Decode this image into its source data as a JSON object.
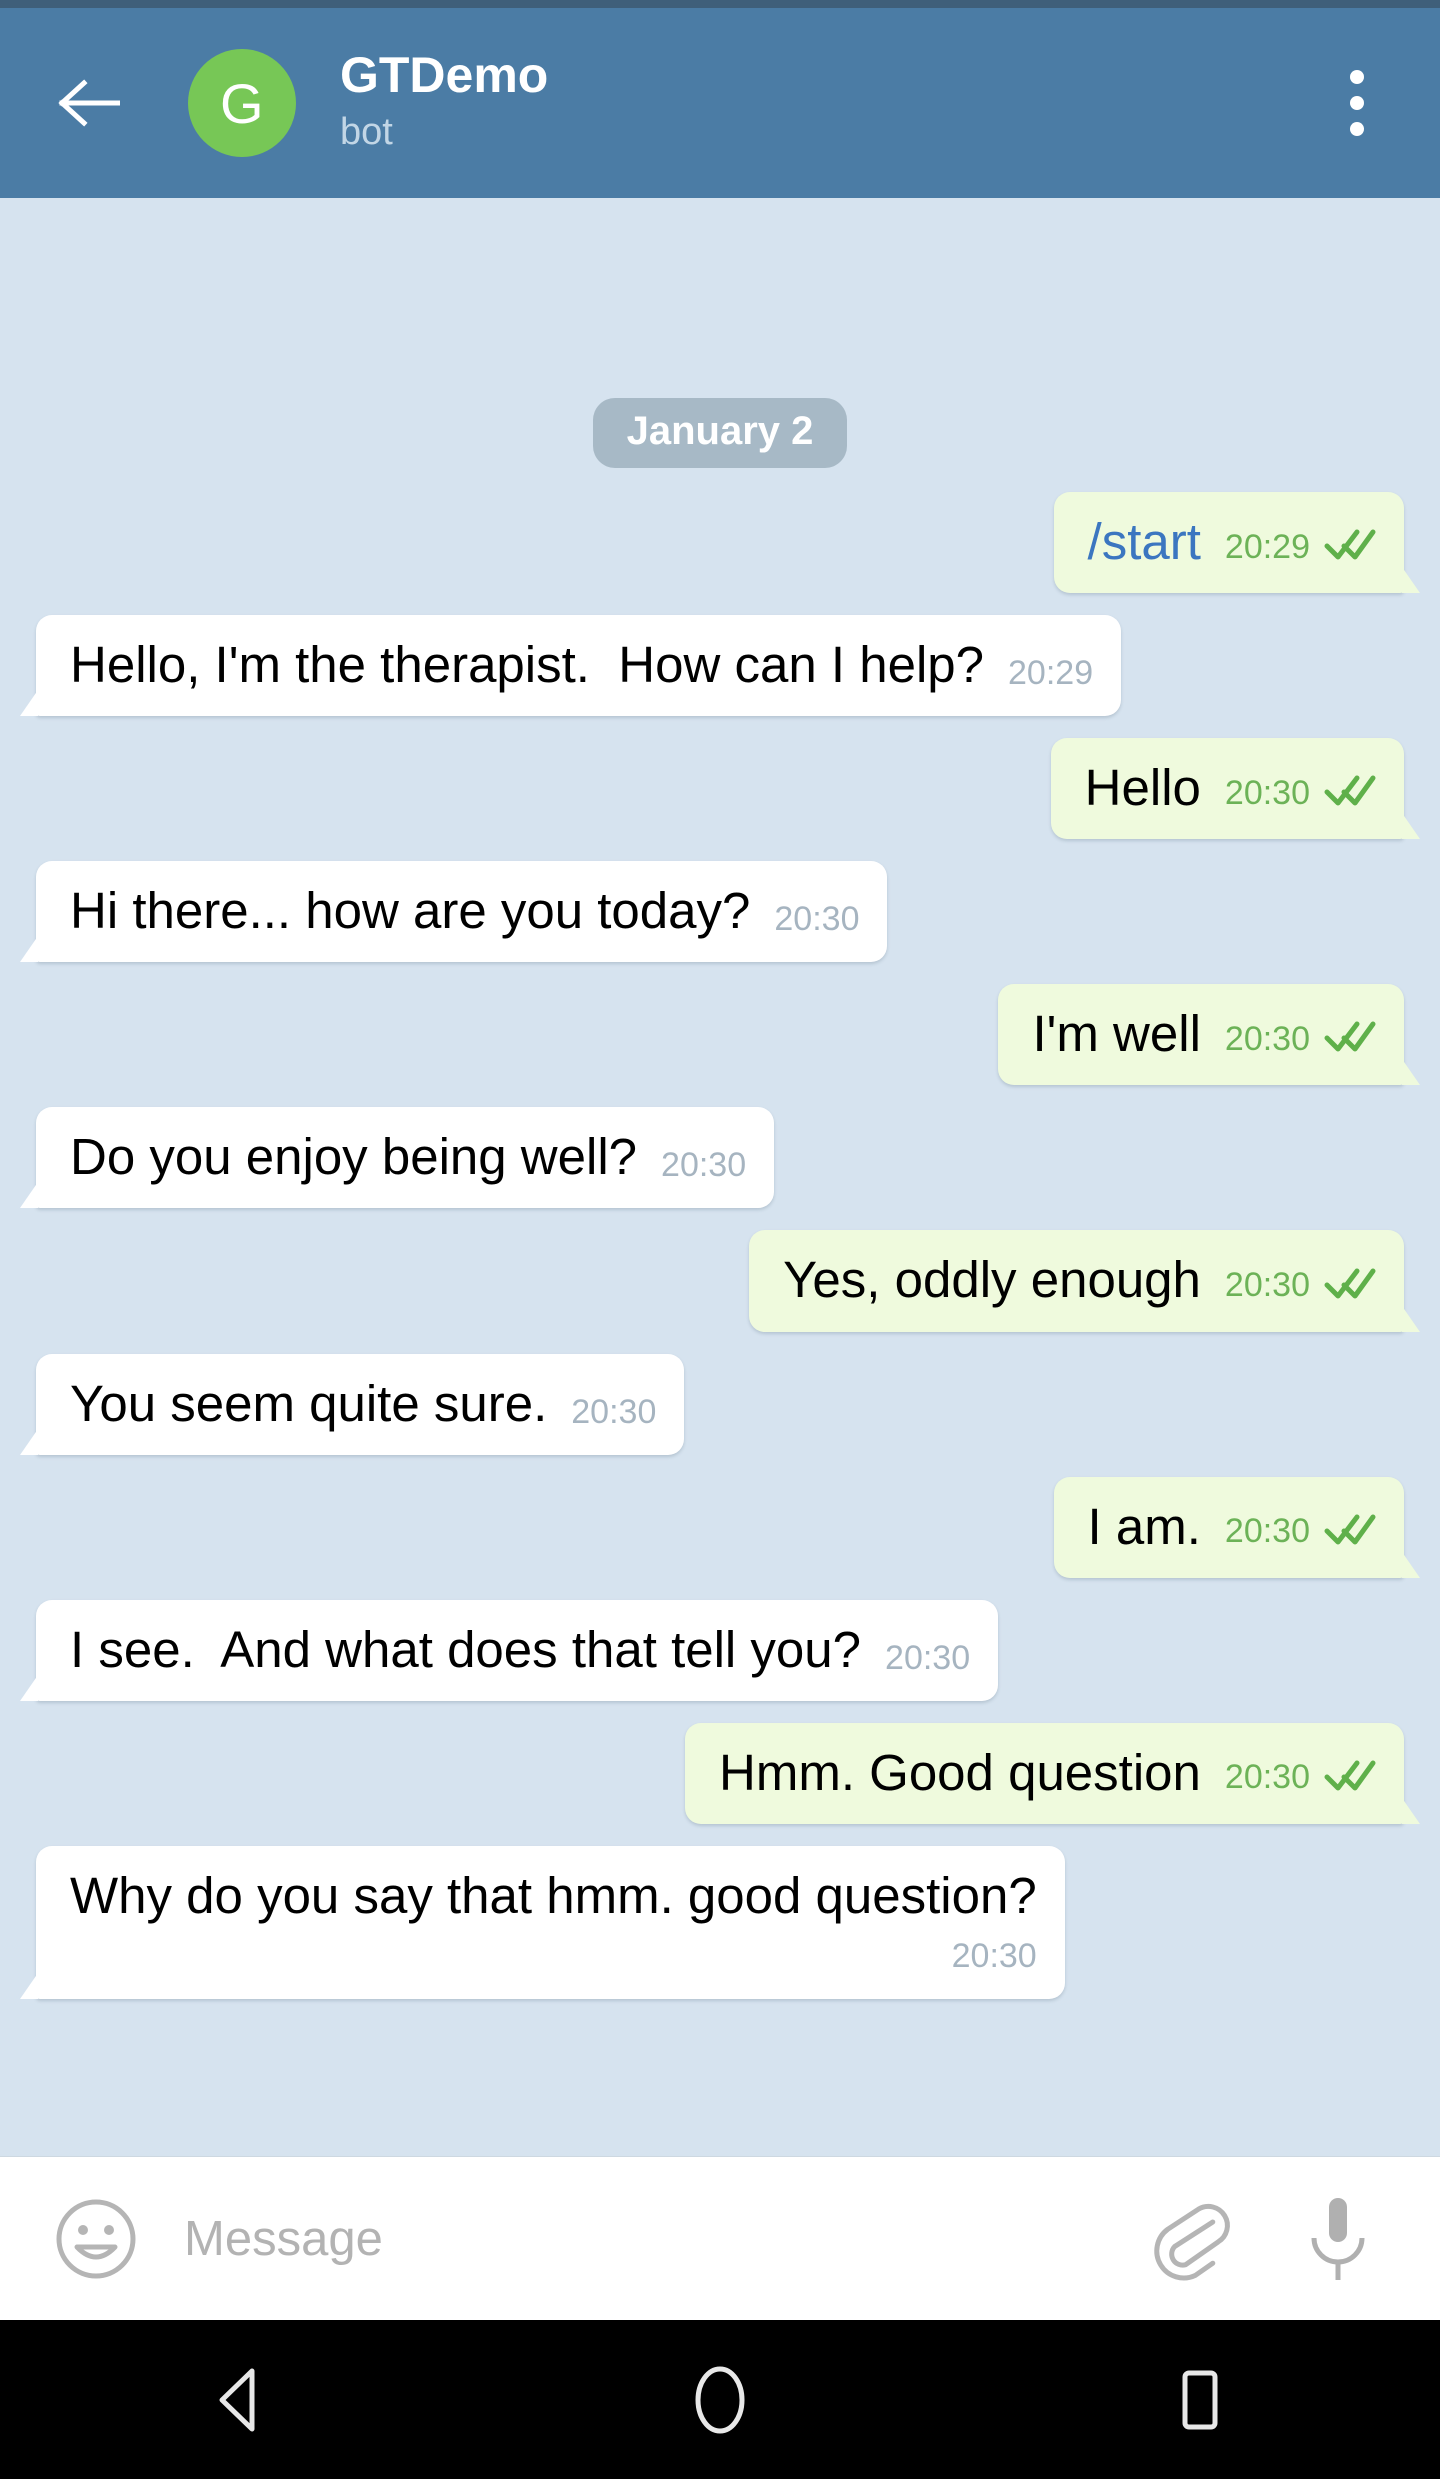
{
  "header": {
    "back_icon": "arrow-left-icon",
    "avatar_letter": "G",
    "title": "GTDemo",
    "subtitle": "bot",
    "menu_icon": "overflow-menu-icon",
    "bg_color": "#4b7ca5",
    "avatar_color": "#77c756"
  },
  "chat": {
    "background_color": "#d6e3ef",
    "date_separator": "January 2",
    "messages": [
      {
        "id": "m1",
        "from": "out",
        "text": "/start",
        "time": "20:29",
        "status": "read",
        "link": true,
        "wrap": false
      },
      {
        "id": "m2",
        "from": "in",
        "text": "Hello, I'm the therapist.  How can I help?",
        "time": "20:29",
        "status": "",
        "link": false,
        "wrap": false
      },
      {
        "id": "m3",
        "from": "out",
        "text": "Hello",
        "time": "20:30",
        "status": "read",
        "link": false,
        "wrap": false
      },
      {
        "id": "m4",
        "from": "in",
        "text": "Hi there... how are you today?",
        "time": "20:30",
        "status": "",
        "link": false,
        "wrap": false
      },
      {
        "id": "m5",
        "from": "out",
        "text": "I'm well",
        "time": "20:30",
        "status": "read",
        "link": false,
        "wrap": false
      },
      {
        "id": "m6",
        "from": "in",
        "text": "Do you enjoy being well?",
        "time": "20:30",
        "status": "",
        "link": false,
        "wrap": false
      },
      {
        "id": "m7",
        "from": "out",
        "text": "Yes, oddly enough",
        "time": "20:30",
        "status": "read",
        "link": false,
        "wrap": false
      },
      {
        "id": "m8",
        "from": "in",
        "text": "You seem quite sure.",
        "time": "20:30",
        "status": "",
        "link": false,
        "wrap": false
      },
      {
        "id": "m9",
        "from": "out",
        "text": "I am.",
        "time": "20:30",
        "status": "read",
        "link": false,
        "wrap": false
      },
      {
        "id": "m10",
        "from": "in",
        "text": "I see.  And what does that tell you?",
        "time": "20:30",
        "status": "",
        "link": false,
        "wrap": false
      },
      {
        "id": "m11",
        "from": "out",
        "text": "Hmm. Good question",
        "time": "20:30",
        "status": "read",
        "link": false,
        "wrap": false
      },
      {
        "id": "m12",
        "from": "in",
        "text": "Why do you say that hmm. good question?",
        "time": "20:30",
        "status": "",
        "link": false,
        "wrap": true
      }
    ],
    "bubble_in_color": "#ffffff",
    "bubble_out_color": "#effadd",
    "time_in_color": "#a6b4c0",
    "time_out_color": "#6cb257",
    "link_color": "#3b76c0",
    "date_badge_color": "#a7b9c6"
  },
  "composer": {
    "emoji_icon": "smiley-icon",
    "placeholder": "Message",
    "value": "",
    "attach_icon": "paperclip-icon",
    "mic_icon": "microphone-icon"
  },
  "navbar": {
    "back_icon": "nav-back-triangle-icon",
    "home_icon": "nav-home-circle-icon",
    "recents_icon": "nav-recents-square-icon"
  }
}
